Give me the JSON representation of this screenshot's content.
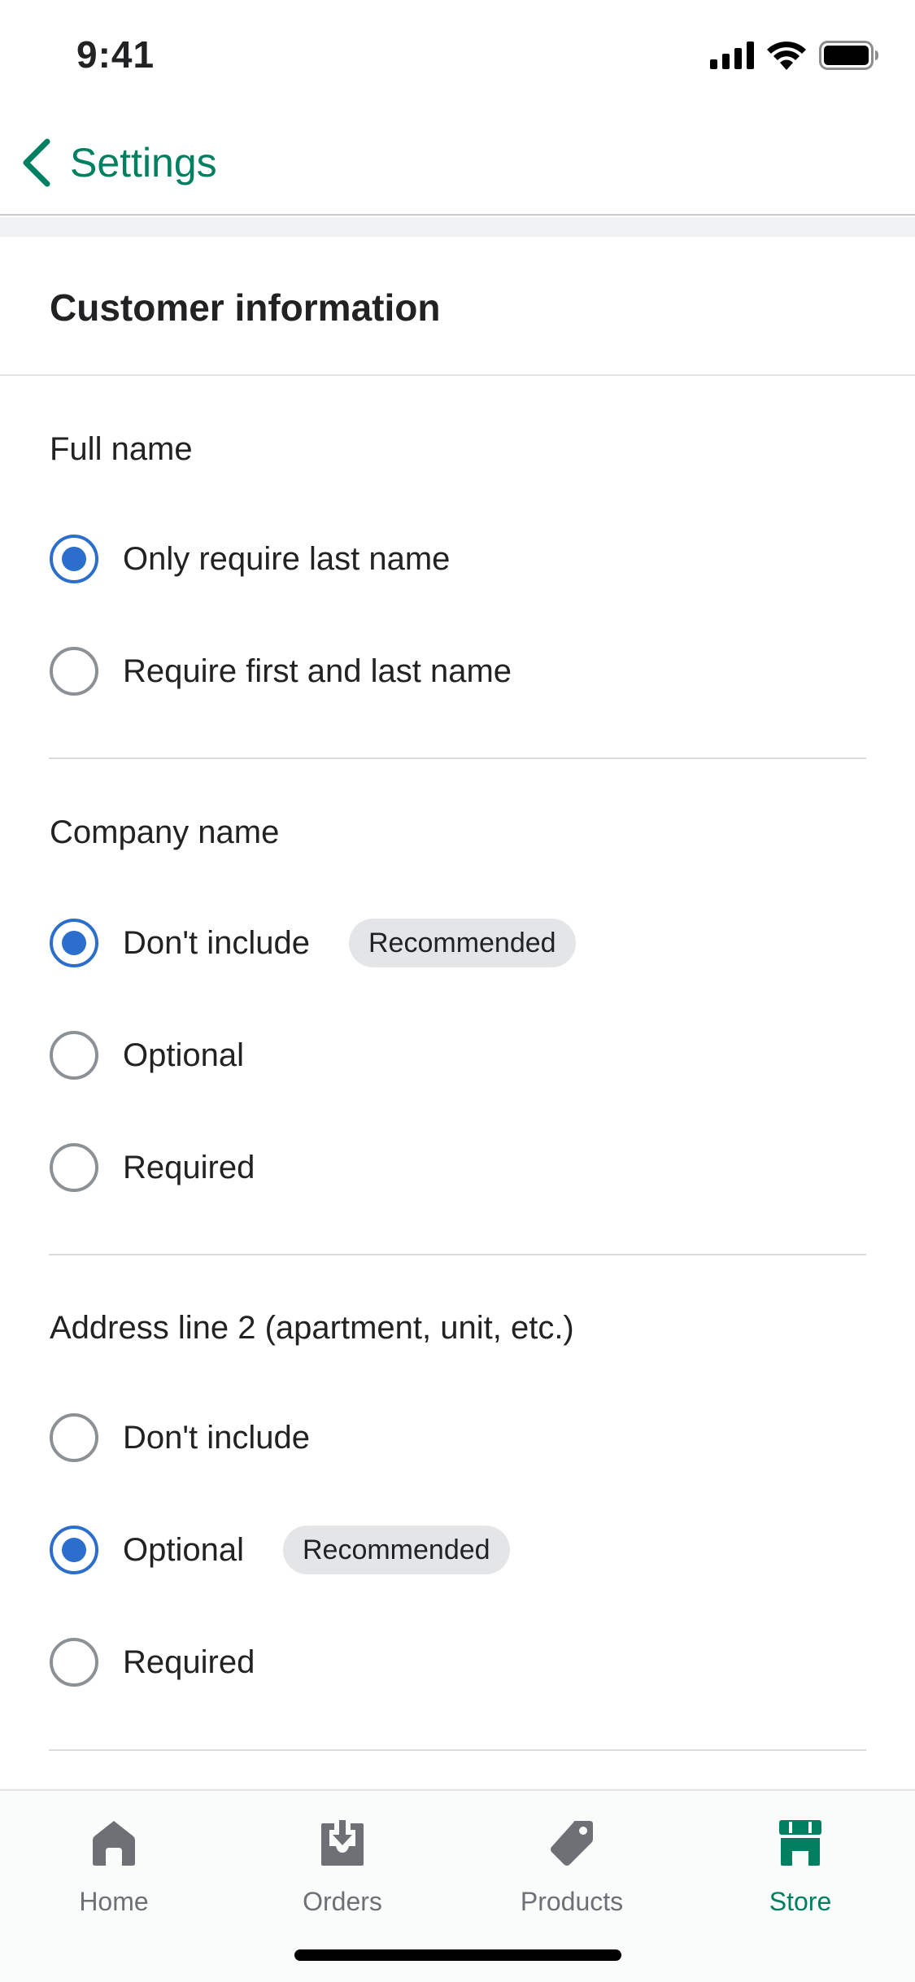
{
  "status_bar": {
    "time": "9:41",
    "icons": [
      "cellular-signal-icon",
      "wifi-icon",
      "battery-icon"
    ]
  },
  "nav": {
    "back_icon": "chevron-left-icon",
    "back_label": "Settings"
  },
  "section": {
    "title": "Customer information"
  },
  "groups": {
    "full_name": {
      "label": "Full name",
      "options": [
        {
          "label": "Only require last name",
          "selected": true
        },
        {
          "label": "Require first and last name",
          "selected": false
        }
      ]
    },
    "company_name": {
      "label": "Company name",
      "options": [
        {
          "label": "Don't include",
          "selected": true,
          "badge": "Recommended"
        },
        {
          "label": "Optional",
          "selected": false
        },
        {
          "label": "Required",
          "selected": false
        }
      ]
    },
    "address_line_2": {
      "label": "Address line 2 (apartment, unit, etc.)",
      "options": [
        {
          "label": "Don't include",
          "selected": false
        },
        {
          "label": "Optional",
          "selected": true,
          "badge": "Recommended"
        },
        {
          "label": "Required",
          "selected": false
        }
      ]
    }
  },
  "tab_bar": {
    "tabs": [
      {
        "label": "Home",
        "icon": "home-icon",
        "active": false
      },
      {
        "label": "Orders",
        "icon": "orders-inbox-icon",
        "active": false
      },
      {
        "label": "Products",
        "icon": "tag-icon",
        "active": false
      },
      {
        "label": "Store",
        "icon": "store-icon",
        "active": true
      }
    ]
  },
  "colors": {
    "accent_green": "#008060",
    "radio_selected": "#2c6ecb",
    "radio_unselected": "#8c9196",
    "badge_bg": "#e4e5e7",
    "tab_inactive": "#6d7175"
  }
}
